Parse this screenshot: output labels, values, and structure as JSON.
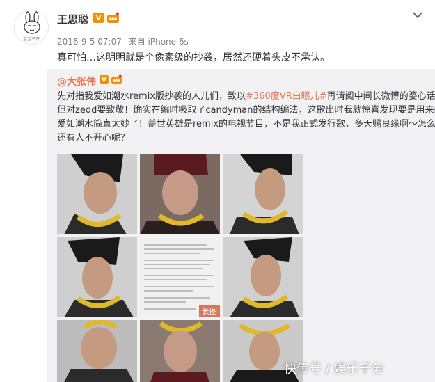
{
  "post": {
    "author": "王思聪",
    "verified_badge": "V",
    "avatar_caption": "宝宝不开",
    "timestamp": "2016-9-5 07:07",
    "source": "来自 iPhone 6s",
    "text": "真可怕…这明明就是个像素级的抄袭，居然还硬着头皮不承认。"
  },
  "repost": {
    "author": "@大张伟",
    "verified_badge": "V",
    "text_line1_a": "先对指我爱如潮水remix版抄袭的人儿们，致以",
    "hashtag": "#360度VR白眼儿#",
    "text_line1_b": "再请阅中间长微博的婆心话。",
    "text_line2": "但对zedd要致敬！确实在编时吸取了candyman的结构编法，这歌出时我就惊喜发现要是用来re",
    "text_line3": "爱如潮水简直太妙了！盖世英雄是remix的电视节目，不是我正式发行歌，多天赐良缘啊～怎么",
    "text_line4": "还有人不开心呢？",
    "long_image_label": "长图"
  },
  "watermark": "快传号 / 娱乐千分",
  "colors": {
    "link": "#eb7350",
    "repost_bg": "#f2f2f5",
    "badge": "#f29100"
  },
  "icons": [
    "avatar-cartoon",
    "verified-v-badge",
    "crown-icon",
    "chevron-down-icon"
  ]
}
